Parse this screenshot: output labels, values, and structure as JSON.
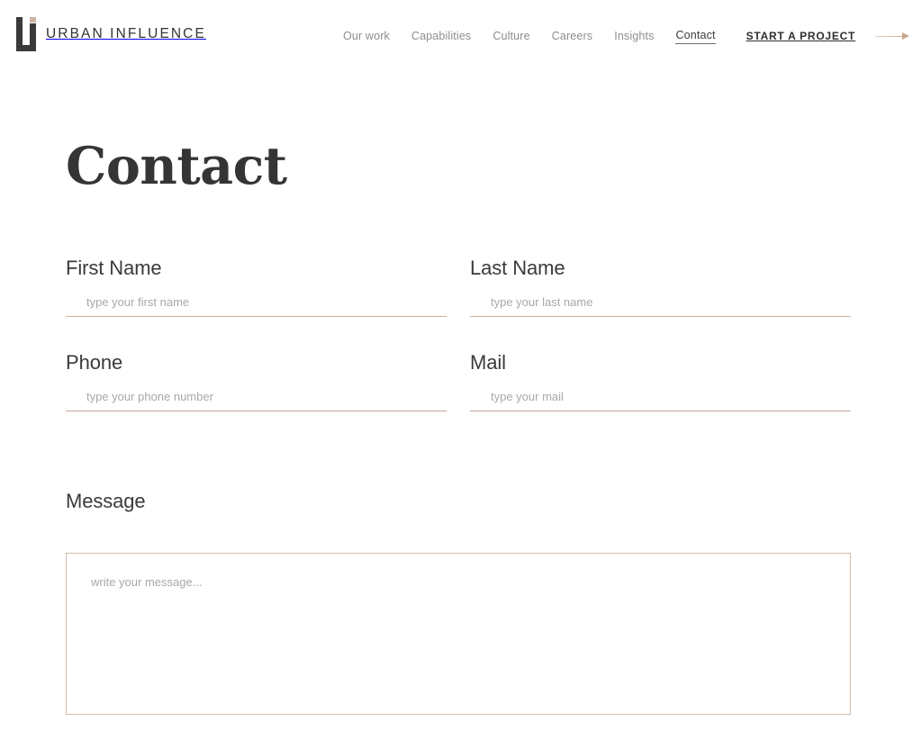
{
  "site": {
    "brand_name": "URBAN INFLUENCE",
    "logo_icon": "urban-influence-u-monogram",
    "accent_color": "#cbb3a5",
    "text_color": "#3a3a3a"
  },
  "header": {
    "nav_items": [
      {
        "label": "Our work",
        "active": false
      },
      {
        "label": "Capabilities",
        "active": false
      },
      {
        "label": "Culture",
        "active": false
      },
      {
        "label": "Careers",
        "active": false
      },
      {
        "label": "Insights",
        "active": false
      },
      {
        "label": "Contact",
        "active": true
      }
    ],
    "cta": {
      "label": "START A PROJECT",
      "arrow_icon": "arrow-right-icon",
      "arrow_color": "#c9a68a"
    }
  },
  "main": {
    "page_title": "Contact",
    "form": {
      "rows": [
        {
          "fields": [
            {
              "label": "First Name",
              "placeholder": "type your first name",
              "value": "",
              "underline_color": "#cbb49f"
            },
            {
              "label": "Last Name",
              "placeholder": "type your last name",
              "value": "",
              "underline_color": "#cbb49f"
            }
          ]
        },
        {
          "fields": [
            {
              "label": "Phone",
              "placeholder": "type your phone number",
              "value": "",
              "underline_color": "#c9a69d"
            },
            {
              "label": "Mail",
              "placeholder": "type your mail",
              "value": "",
              "underline_color": "#c9a69d"
            }
          ]
        }
      ],
      "message": {
        "label": "Message",
        "placeholder": "write your message...",
        "value": "",
        "border_color": "#d3bda9"
      }
    }
  }
}
